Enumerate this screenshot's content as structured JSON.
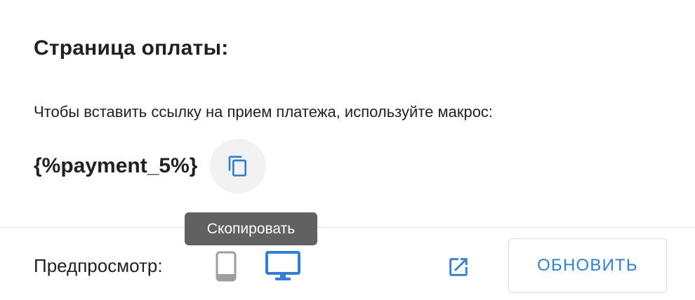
{
  "payment_page": {
    "title": "Страница оплаты:",
    "hint": "Чтобы вставить ссылку на прием платежа, используйте макрос:",
    "macro": "{%payment_5%}",
    "copy_tooltip": "Скопировать"
  },
  "footer": {
    "preview_label": "Предпросмотр:",
    "refresh_label": "ОБНОВИТЬ"
  },
  "icons": {
    "copy": "copy-icon",
    "mobile": "mobile-phone-icon",
    "desktop": "desktop-monitor-icon",
    "external": "open-in-new-icon"
  },
  "colors": {
    "accent": "#2f7fde",
    "inactive_icon": "#9e9e9e",
    "tooltip_bg": "#616161"
  }
}
